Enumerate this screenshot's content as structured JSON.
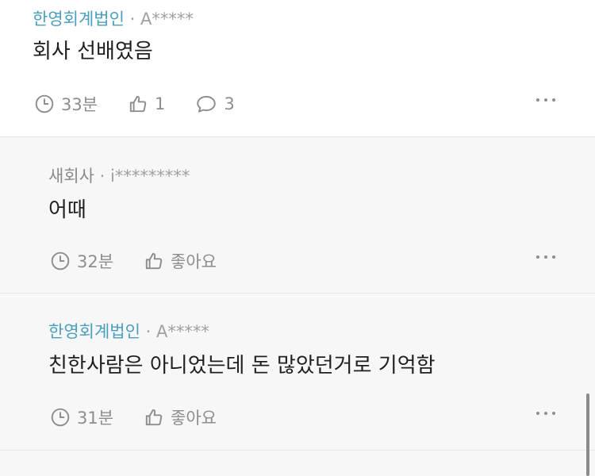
{
  "comments": [
    {
      "company": "한영회계법인",
      "separator": "·",
      "user": "A*****",
      "text": "회사 선배였음",
      "time": "33분",
      "likes": "1",
      "replies": "3"
    },
    {
      "company": "새회사",
      "separator": "·",
      "user": "i*********",
      "text": "어때",
      "time": "32분",
      "like_label": "좋아요"
    },
    {
      "company": "한영회계법인",
      "separator": "·",
      "user": "A*****",
      "text": "친한사람은 아니었는데 돈 많았던거로 기억함",
      "time": "31분",
      "like_label": "좋아요"
    }
  ],
  "icons": {
    "clock": "clock-icon",
    "like": "thumbs-up-icon",
    "reply": "comment-bubble-icon",
    "more": "more-dots-icon"
  },
  "colors": {
    "company_link": "#4a9fbf",
    "reply_background": "#f7f7f8",
    "icon_gray": "#8d8d91"
  }
}
